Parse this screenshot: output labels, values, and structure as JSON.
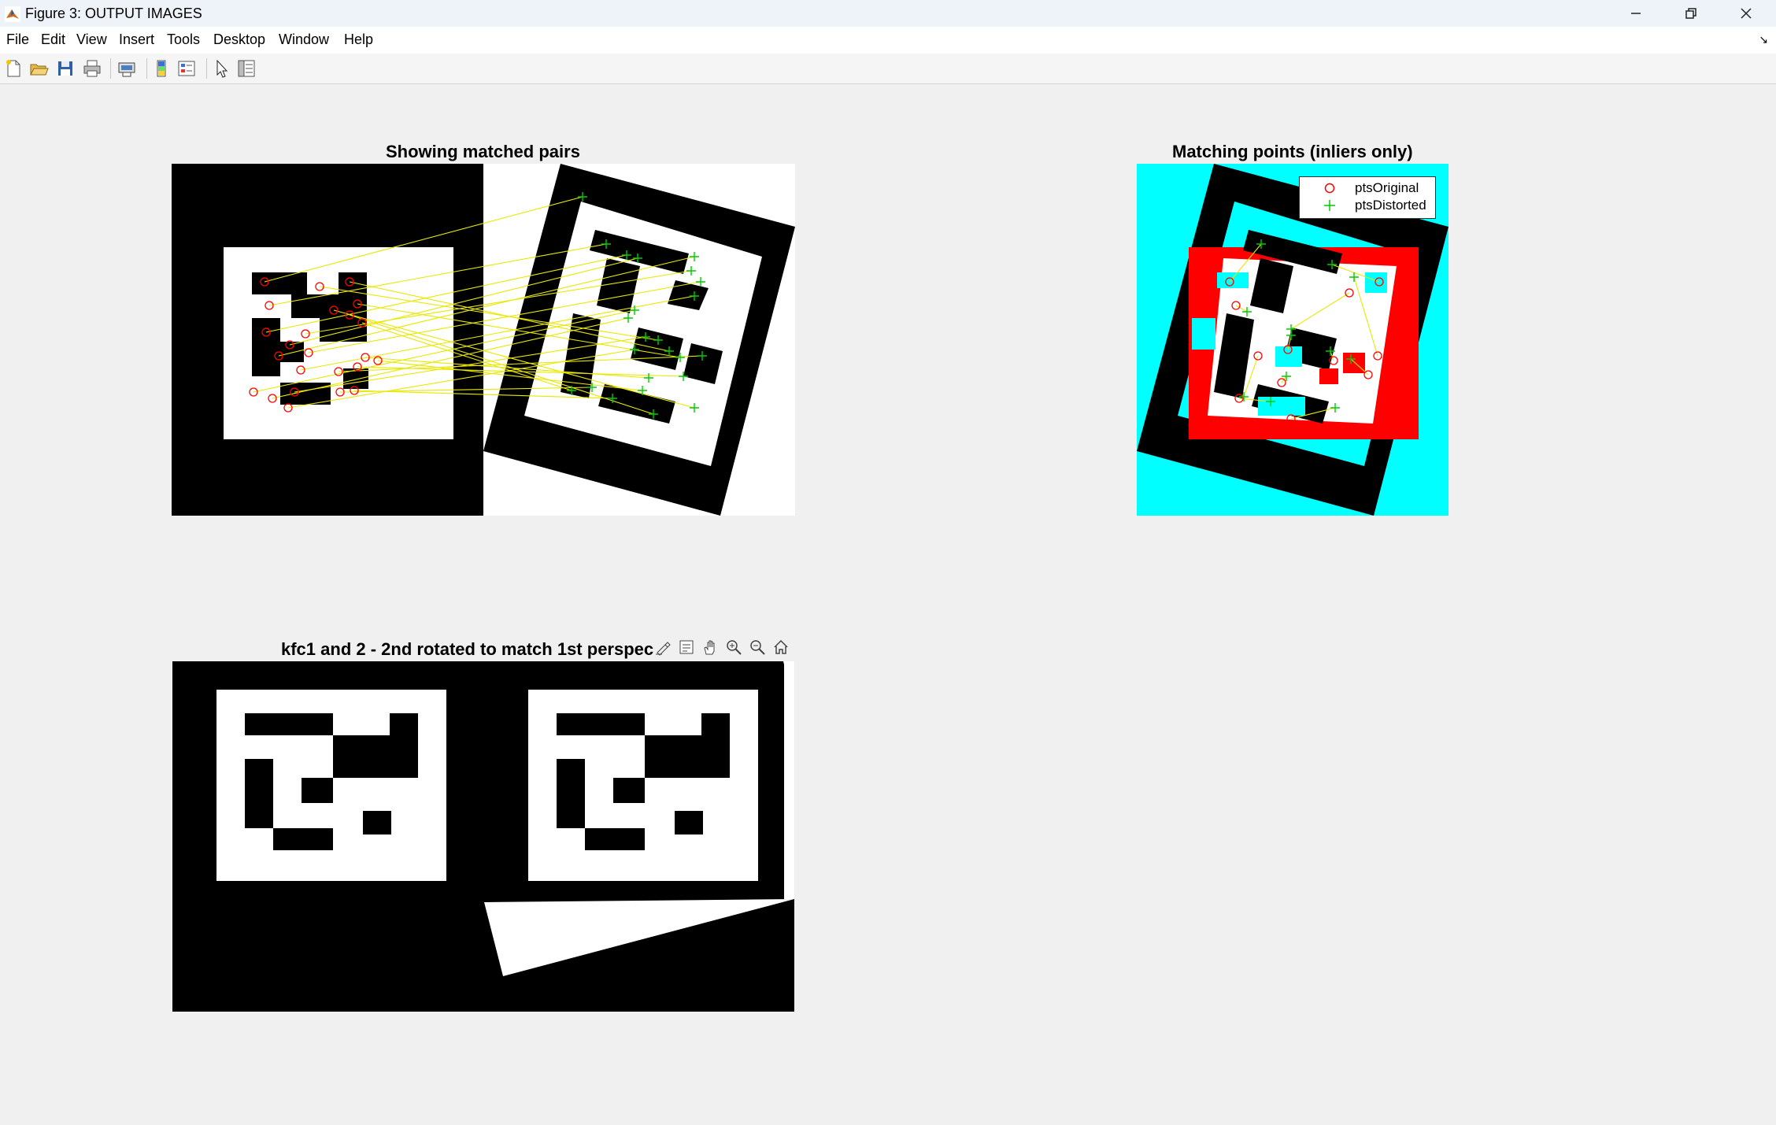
{
  "window": {
    "title": "Figure 3: OUTPUT IMAGES",
    "minimize_icon": "minimize-icon",
    "restore_icon": "restore-icon",
    "close_icon": "close-icon"
  },
  "menu": {
    "items": [
      "File",
      "Edit",
      "View",
      "Insert",
      "Tools",
      "Desktop",
      "Window",
      "Help"
    ]
  },
  "toolbar": {
    "icons": [
      "new-figure-icon",
      "open-file-icon",
      "save-icon",
      "print-icon",
      "link-plot-icon",
      "colorbar-icon",
      "legend-icon",
      "select-pointer-icon",
      "property-inspector-icon"
    ]
  },
  "axes": {
    "matched_pairs": {
      "title": "Showing matched pairs"
    },
    "inliers": {
      "title": "Matching points (inliers only)",
      "legend": {
        "original": "ptsOriginal",
        "distorted": "ptsDistorted"
      }
    },
    "rotated": {
      "title": "kfc1 and 2 - 2nd rotated to match 1st perspec",
      "toolbar_icons": [
        "brush-icon",
        "data-tips-icon",
        "pan-hand-icon",
        "zoom-in-icon",
        "zoom-out-icon",
        "home-icon"
      ]
    }
  },
  "colors": {
    "match_line": "#e8e800",
    "original_marker": "#ff0000",
    "distorted_marker": "#00cc00",
    "cyan": "#00ffff",
    "red": "#ff0000"
  }
}
